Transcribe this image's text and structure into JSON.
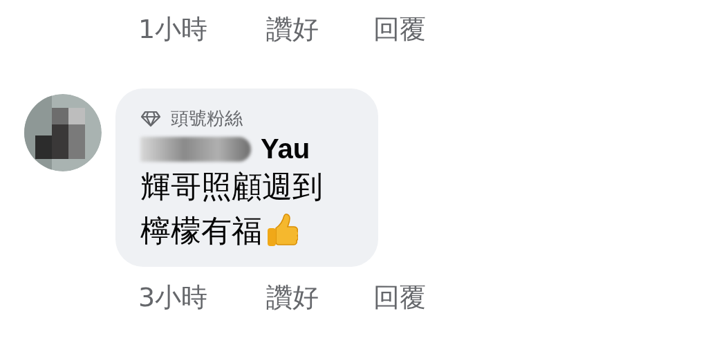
{
  "previous_comment": {
    "actions": [
      {
        "kind": "time",
        "label": "1小時"
      },
      {
        "kind": "like",
        "label": "讚好"
      },
      {
        "kind": "reply",
        "label": "回覆"
      }
    ]
  },
  "comment": {
    "badge": "頭號粉絲",
    "author": "Yau",
    "lines": [
      "輝哥照顧週到",
      "檸檬有福"
    ],
    "actions": [
      {
        "kind": "time",
        "label": "3小時"
      },
      {
        "kind": "like",
        "label": "讚好"
      },
      {
        "kind": "reply",
        "label": "回覆"
      }
    ]
  }
}
